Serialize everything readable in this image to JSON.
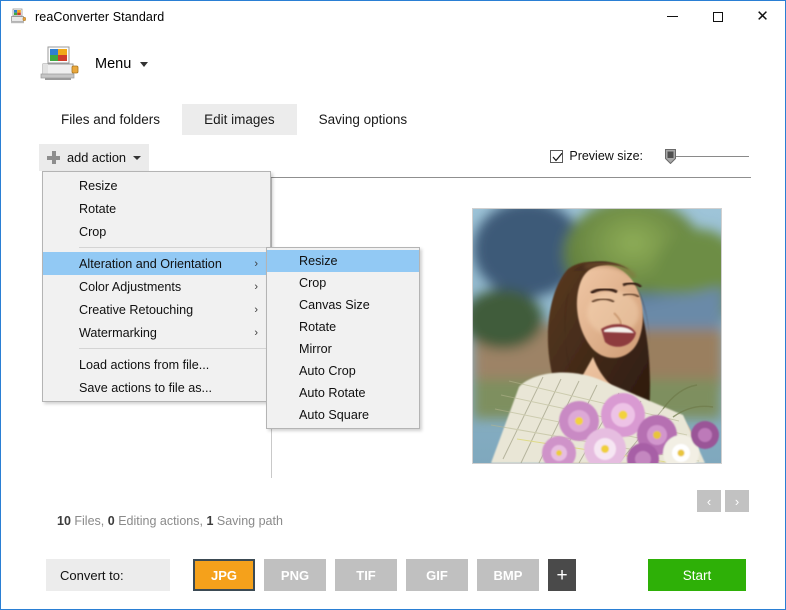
{
  "window": {
    "title": "reaConverter Standard",
    "icon": "printer-icon",
    "controls": {
      "minimize": "—",
      "maximize": "□",
      "close": "✕"
    }
  },
  "menubar": {
    "menu_label": "Menu",
    "logo_icon": "printer-image-icon"
  },
  "tabs": [
    {
      "label": "Files and folders",
      "active": false
    },
    {
      "label": "Edit images",
      "active": true
    },
    {
      "label": "Saving options",
      "active": false
    }
  ],
  "toolbar": {
    "add_action_label": "add action",
    "preview_size_label": "Preview size:",
    "preview_size_checked": true,
    "slider_value": 0
  },
  "dropdown": {
    "items": [
      {
        "label": "Resize",
        "submenu": false,
        "selected": false
      },
      {
        "label": "Rotate",
        "submenu": false,
        "selected": false
      },
      {
        "label": "Crop",
        "submenu": false,
        "selected": false
      },
      {
        "label": "Alteration and Orientation",
        "submenu": true,
        "selected": true
      },
      {
        "label": "Color Adjustments",
        "submenu": true,
        "selected": false
      },
      {
        "label": "Creative Retouching",
        "submenu": true,
        "selected": false
      },
      {
        "label": "Watermarking",
        "submenu": true,
        "selected": false
      },
      {
        "label": "Load actions from file...",
        "submenu": false,
        "selected": false
      },
      {
        "label": "Save actions to file as...",
        "submenu": false,
        "selected": false
      }
    ],
    "submenu_arrow": "›"
  },
  "submenu": {
    "items": [
      {
        "label": "Resize",
        "selected": true
      },
      {
        "label": "Crop",
        "selected": false
      },
      {
        "label": "Canvas Size",
        "selected": false
      },
      {
        "label": "Rotate",
        "selected": false
      },
      {
        "label": "Mirror",
        "selected": false
      },
      {
        "label": "Auto Crop",
        "selected": false
      },
      {
        "label": "Auto Rotate",
        "selected": false
      },
      {
        "label": "Auto Square",
        "selected": false
      }
    ]
  },
  "preview": {
    "alt": "woman-holding-bouquet-photo"
  },
  "status": {
    "files_count": "10",
    "files_label": "Files,",
    "actions_count": "0",
    "actions_label": "Editing actions,",
    "paths_count": "1",
    "paths_label": "Saving path"
  },
  "nav": {
    "prev": "‹",
    "next": "›"
  },
  "bottom": {
    "convert_to_label": "Convert to:",
    "formats": [
      {
        "label": "JPG",
        "active": true
      },
      {
        "label": "PNG",
        "active": false
      },
      {
        "label": "TIF",
        "active": false
      },
      {
        "label": "GIF",
        "active": false
      },
      {
        "label": "BMP",
        "active": false
      }
    ],
    "add_format": "+",
    "start_label": "Start"
  },
  "colors": {
    "accent_orange": "#f5a11b",
    "start_green": "#2eb007",
    "menu_highlight": "#92c9f4",
    "window_border": "#2a7fd4"
  }
}
